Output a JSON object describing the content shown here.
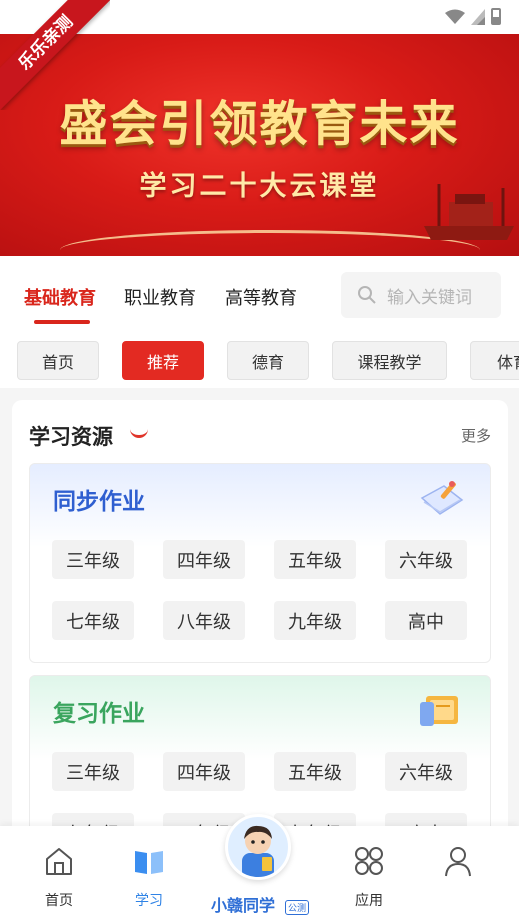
{
  "ribbon_text": "乐乐亲测",
  "banner": {
    "title": "盛会引领教育未来",
    "subtitle": "学习二十大云课堂"
  },
  "category_tabs": [
    {
      "label": "基础教育",
      "active": true
    },
    {
      "label": "职业教育",
      "active": false
    },
    {
      "label": "高等教育",
      "active": false
    }
  ],
  "search": {
    "placeholder": "输入关键词",
    "icon": "search-icon"
  },
  "chips": [
    {
      "label": "首页",
      "active": false
    },
    {
      "label": "推荐",
      "active": true
    },
    {
      "label": "德育",
      "active": false
    },
    {
      "label": "课程教学",
      "active": false
    },
    {
      "label": "体育",
      "active": false
    }
  ],
  "section": {
    "title": "学习资源",
    "more": "更多"
  },
  "resources": [
    {
      "name": "同步作业",
      "icon": "notebook-pencil-icon",
      "grades": [
        "三年级",
        "四年级",
        "五年级",
        "六年级",
        "七年级",
        "八年级",
        "九年级",
        "高中"
      ]
    },
    {
      "name": "复习作业",
      "icon": "book-stack-icon",
      "grades": [
        "三年级",
        "四年级",
        "五年级",
        "六年级",
        "七年级",
        "八年级",
        "九年级",
        "高中"
      ]
    }
  ],
  "bottom_nav": {
    "items": [
      {
        "label": "首页",
        "icon": "home-icon",
        "active": false
      },
      {
        "label": "学习",
        "icon": "book-open-icon",
        "active": true
      },
      {
        "label": "应用",
        "icon": "apps-grid-icon",
        "active": false
      },
      {
        "label": "",
        "icon": "user-icon",
        "active": false
      }
    ],
    "center_label": "小赣同学",
    "center_badge": "公测"
  },
  "colors": {
    "accent_red": "#d9261c",
    "active_blue": "#2f83e6",
    "sync_blue": "#2f5fd0",
    "review_green": "#3aa55e"
  }
}
